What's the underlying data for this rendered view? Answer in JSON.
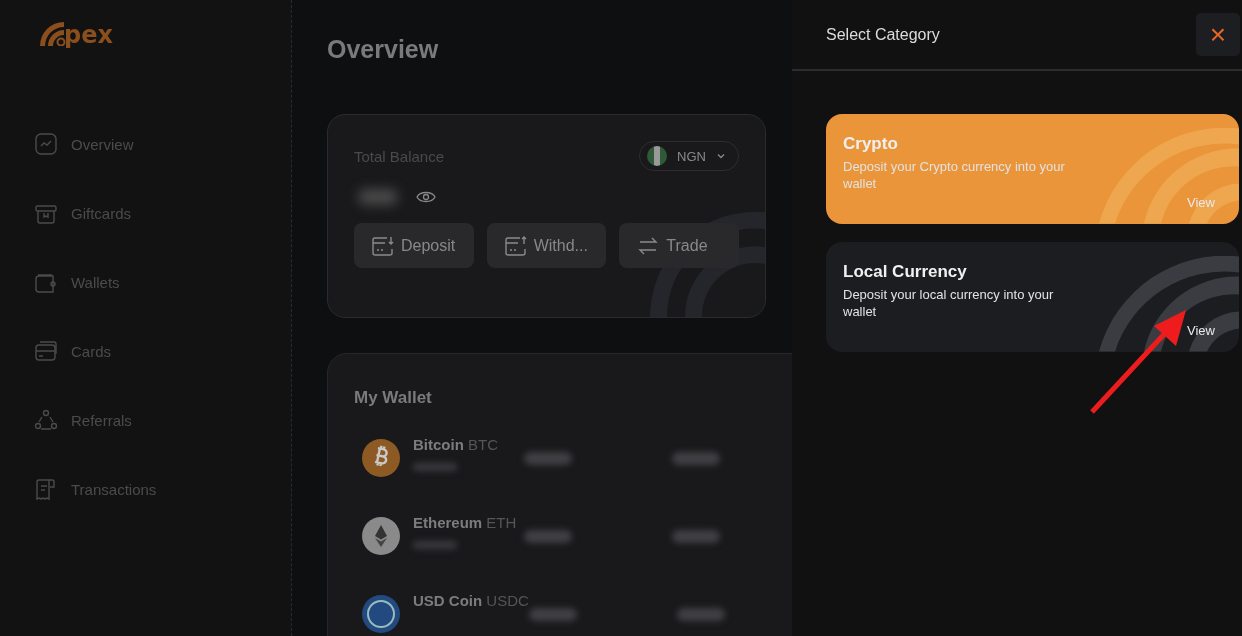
{
  "logo": {
    "text": "pex"
  },
  "sidebar": {
    "items": [
      {
        "label": "Overview",
        "selected": false
      },
      {
        "label": "Giftcards",
        "selected": false
      },
      {
        "label": "Wallets",
        "selected": false
      },
      {
        "label": "Cards",
        "selected": false
      },
      {
        "label": "Referrals",
        "selected": false
      },
      {
        "label": "Transactions",
        "selected": false
      }
    ]
  },
  "page_title": "Overview",
  "balance_card": {
    "label": "Total Balance",
    "currency": "NGN",
    "actions": [
      {
        "label": "Deposit"
      },
      {
        "label": "Withd..."
      },
      {
        "label": "Trade"
      }
    ]
  },
  "wallet": {
    "title": "My Wallet",
    "coins": [
      {
        "name": "Bitcoin",
        "symbol": "BTC",
        "kind": "btc"
      },
      {
        "name": "Ethereum",
        "symbol": "ETH",
        "kind": "eth"
      },
      {
        "name": "USD Coin",
        "symbol": "USDC",
        "kind": "usdc"
      }
    ]
  },
  "drawer": {
    "title": "Select Category",
    "close": "×",
    "categories": [
      {
        "title": "Crypto",
        "description": "Deposit your Crypto currency into your wallet",
        "action": "View",
        "selected": true
      },
      {
        "title": "Local Currency",
        "description": "Deposit your local currency into your wallet",
        "action": "View",
        "selected": false
      }
    ]
  }
}
